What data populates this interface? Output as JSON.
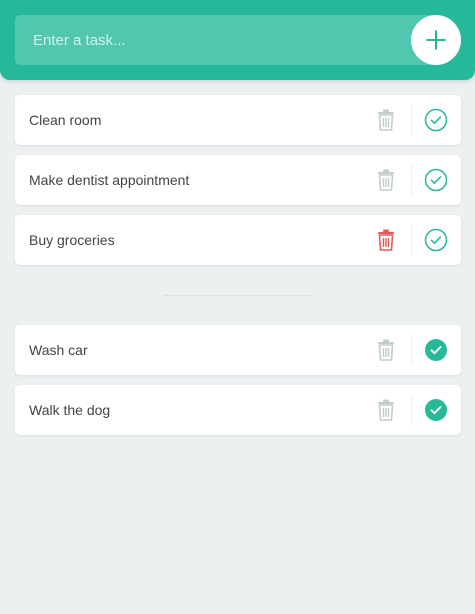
{
  "header": {
    "input_placeholder": "Enter a task...",
    "add_icon": "plus-icon"
  },
  "colors": {
    "brand": "#25b99a",
    "background": "#edf0f1",
    "trash_default": "#c0cecb",
    "trash_active": "#e85656",
    "check": "#25b99a"
  },
  "todo": {
    "items": [
      {
        "text": "Clean room",
        "remove_state": "default"
      },
      {
        "text": "Make dentist appointment",
        "remove_state": "default"
      },
      {
        "text": "Buy groceries",
        "remove_state": "hover"
      }
    ]
  },
  "completed": {
    "items": [
      {
        "text": "Wash car"
      },
      {
        "text": "Walk the dog"
      }
    ]
  },
  "icons": {
    "remove": "trash-icon",
    "complete": "check-circle-icon",
    "completed": "check-circle-filled-icon"
  }
}
